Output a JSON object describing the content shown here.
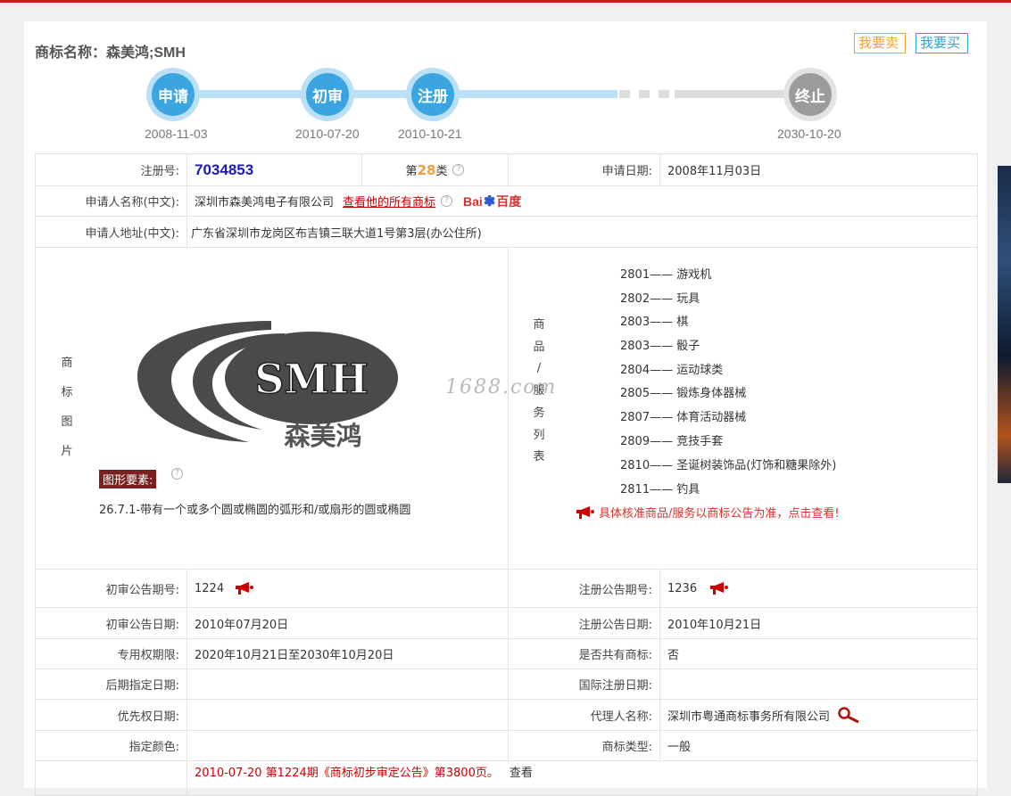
{
  "page": {
    "title": "商标名称：森美鸿;SMH",
    "sell_label": "我要卖",
    "buy_label": "我要买"
  },
  "timeline": {
    "nodes": [
      {
        "label": "申请",
        "date": "2008-11-03",
        "active": true
      },
      {
        "label": "初审",
        "date": "2010-07-20",
        "active": true
      },
      {
        "label": "注册",
        "date": "2010-10-21",
        "active": true
      },
      {
        "label": "终止",
        "date": "2030-10-20",
        "active": false
      }
    ]
  },
  "info": {
    "reg_no_label": "注册号:",
    "reg_no": "7034853",
    "class_prefix": "第",
    "class_no": "28",
    "class_suffix": "类",
    "apply_date_label": "申请日期:",
    "apply_date": "2008年11月03日",
    "applicant_label": "申请人名称(中文):",
    "applicant": "深圳市森美鸿电子有限公司",
    "all_marks_link": "查看他的所有商标",
    "baidu_left": "Bai",
    "baidu_right": "百度",
    "address_label": "申请人地址(中文):",
    "address": "广东省深圳市龙岗区布吉镇三联大道1号第3层(办公住所)"
  },
  "mark_image": {
    "side_label": [
      "商",
      "标",
      "图",
      "片"
    ],
    "logo_text": "SMH",
    "logo_cn": "森美鸿",
    "element_tag": "图形要素:",
    "element_text": "26.7.1-带有一个或多个圆或椭圆的弧形和/或扇形的圆或椭圆",
    "watermark": "1688.com"
  },
  "goods": {
    "side_label": [
      "商",
      "品",
      "/",
      "服",
      "务",
      "列",
      "表"
    ],
    "items": [
      {
        "code": "2801",
        "name": "游戏机"
      },
      {
        "code": "2802",
        "name": "玩具"
      },
      {
        "code": "2803",
        "name": "棋"
      },
      {
        "code": "2803",
        "name": "骰子"
      },
      {
        "code": "2804",
        "name": "运动球类"
      },
      {
        "code": "2805",
        "name": "锻炼身体器械"
      },
      {
        "code": "2807",
        "name": "体育活动器械"
      },
      {
        "code": "2809",
        "name": "竞技手套"
      },
      {
        "code": "2810",
        "name": "圣诞树装饰品(灯饰和糖果除外)"
      },
      {
        "code": "2811",
        "name": "钓具"
      }
    ],
    "dash": "——",
    "notice": "具体核准商品/服务以商标公告为准，点击查看!"
  },
  "details": {
    "prelim_no_label": "初审公告期号:",
    "prelim_no": "1224",
    "reg_notice_no_label": "注册公告期号:",
    "reg_notice_no": "1236",
    "prelim_date_label": "初审公告日期:",
    "prelim_date": "2010年07月20日",
    "reg_notice_date_label": "注册公告日期:",
    "reg_notice_date": "2010年10月21日",
    "exclusive_label": "专用权期限:",
    "exclusive": "2020年10月21日至2030年10月20日",
    "shared_label": "是否共有商标:",
    "shared": "否",
    "later_label": "后期指定日期:",
    "later": "",
    "intl_label": "国际注册日期:",
    "intl": "",
    "priority_label": "优先权日期:",
    "priority": "",
    "agent_label": "代理人名称:",
    "agent": "深圳市粤通商标事务所有限公司",
    "color_label": "指定颜色:",
    "color": "",
    "type_label": "商标类型:",
    "type": "一般",
    "bottom_text": "2010-07-20 第1224期《商标初步审定公告》第3800页。",
    "bottom_link": "查看"
  },
  "colors": {
    "accent_blue": "#3aa5e1",
    "accent_orange": "#f0a035",
    "accent_red": "#d9302c"
  }
}
